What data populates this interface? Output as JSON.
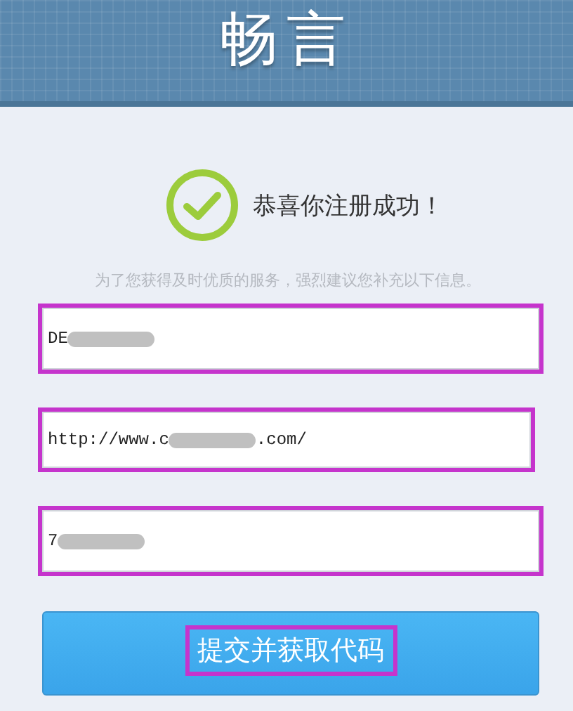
{
  "header": {
    "logo": "畅言"
  },
  "success": {
    "message": "恭喜你注册成功！"
  },
  "hint": "为了您获得及时优质的服务，强烈建议您补充以下信息。",
  "fields": [
    {
      "value_start": "DE",
      "redacted": true,
      "highlighted": true
    },
    {
      "value_start": "http://www.c",
      "redacted": true,
      "value_end": ".com/",
      "highlighted": true
    },
    {
      "value_start": "7",
      "redacted": true,
      "highlighted": true
    }
  ],
  "submit": {
    "label": "提交并获取代码",
    "highlighted": true
  }
}
